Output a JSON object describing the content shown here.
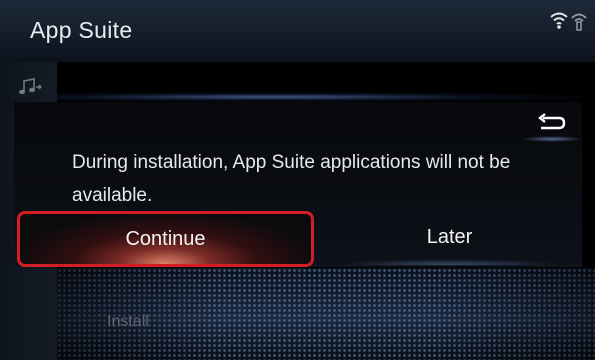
{
  "header": {
    "title": "App Suite",
    "status_icons": [
      "wifi-icon",
      "hotspot-icon"
    ]
  },
  "sidebar": {
    "icon": "music-note-icon"
  },
  "dialog": {
    "message": "During installation, App Suite applications will not be available.",
    "back_icon": "return-arrow-icon",
    "buttons": {
      "continue_label": "Continue",
      "later_label": "Later"
    }
  },
  "background": {
    "install_label": "Install"
  },
  "colors": {
    "highlight_border": "#d21e24",
    "text_primary": "#e8eaee",
    "accent_glow": "#7ea0e0"
  }
}
